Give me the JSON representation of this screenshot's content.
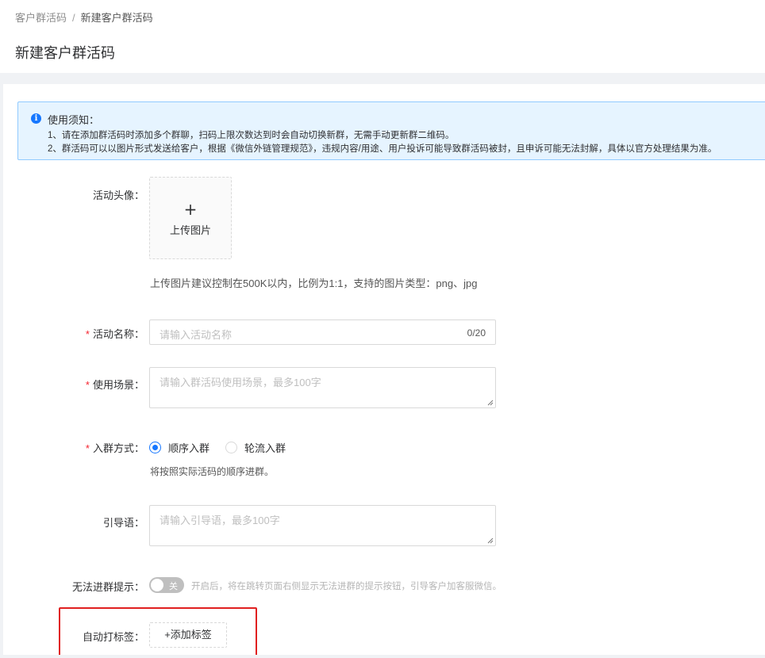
{
  "breadcrumb": {
    "parent": "客户群活码",
    "separator": "/",
    "current": "新建客户群活码"
  },
  "page_title": "新建客户群活码",
  "notice": {
    "icon": "info-icon",
    "title": "使用须知：",
    "lines": [
      "1、请在添加群活码时添加多个群聊，扫码上限次数达到时会自动切换新群，无需手动更新群二维码。",
      "2、群活码可以以图片形式发送给客户，根据《微信外链管理规范》，违规内容/用途、用户投诉可能导致群活码被封，且申诉可能无法封解，具体以官方处理结果为准。"
    ]
  },
  "form": {
    "avatar": {
      "label": "活动头像：",
      "upload_icon": "+",
      "upload_text": "上传图片",
      "hint": "上传图片建议控制在500K以内，比例为1:1，支持的图片类型：png、jpg"
    },
    "name": {
      "required": "*",
      "label": "活动名称：",
      "placeholder": "请输入活动名称",
      "value": "",
      "count": "0/20"
    },
    "scene": {
      "required": "*",
      "label": "使用场景：",
      "placeholder": "请输入群活码使用场景，最多100字",
      "value": ""
    },
    "join_mode": {
      "required": "*",
      "label": "入群方式：",
      "options": [
        {
          "label": "顺序入群",
          "checked": true
        },
        {
          "label": "轮流入群",
          "checked": false
        }
      ],
      "description": "将按照实际活码的顺序进群。"
    },
    "guide": {
      "label": "引导语：",
      "placeholder": "请输入引导语，最多100字",
      "value": ""
    },
    "cannot_join": {
      "label": "无法进群提示：",
      "switch_text": "关",
      "switch_on": false,
      "description": "开启后，将在跳转页面右侧显示无法进群的提示按钮，引导客户加客服微信。"
    },
    "auto_tag": {
      "label": "自动打标签：",
      "button": "+添加标签"
    }
  },
  "colors": {
    "primary": "#1677ff",
    "required": "#f5222d",
    "highlight": "#e02020",
    "notice_bg": "#e6f4ff"
  }
}
